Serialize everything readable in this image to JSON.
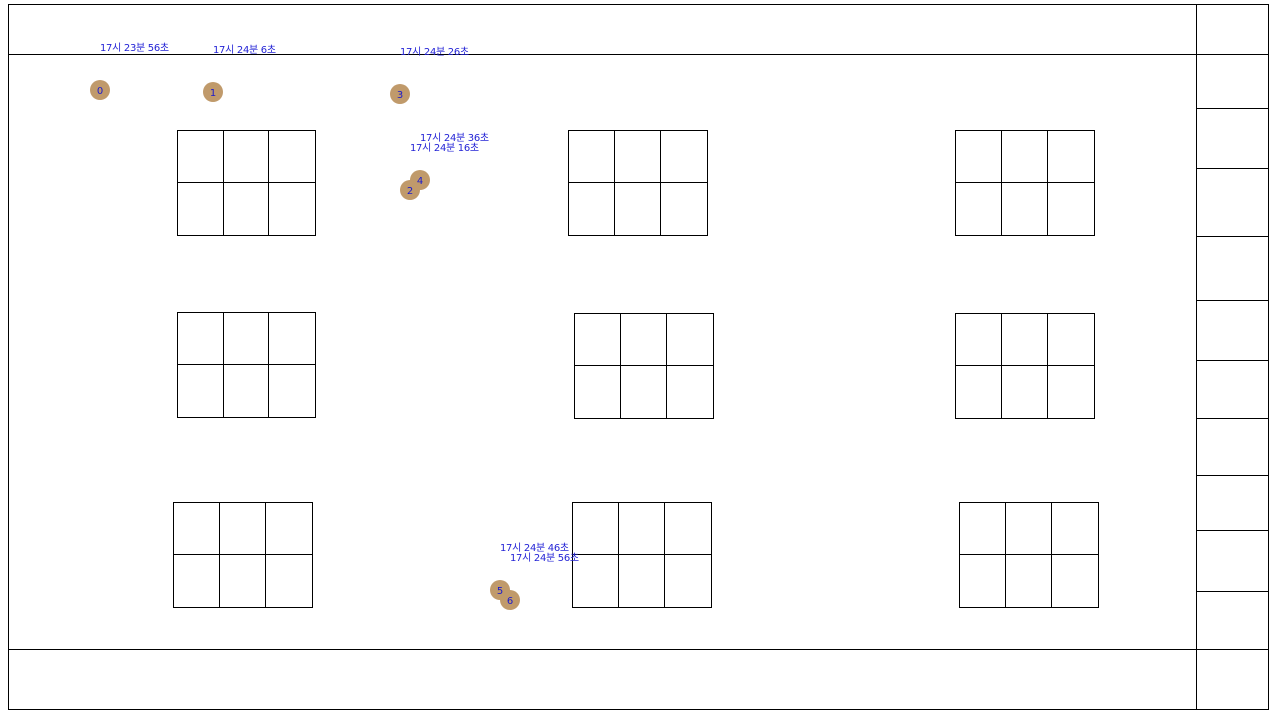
{
  "timestamps": [
    "17시 23분 56초",
    "17시 24분 6초",
    "17시 24분 26초",
    "17시 24분 36초",
    "17시 24분 16초",
    "17시 24분 46초",
    "17시 24분 56초"
  ],
  "markers": [
    "0",
    "1",
    "3",
    "4",
    "2",
    "5",
    "6"
  ],
  "colors": {
    "marker": "#c09a6b",
    "marker_text": "#1a1acd",
    "stamp_text": "#2424d6",
    "lines": "#000000"
  }
}
